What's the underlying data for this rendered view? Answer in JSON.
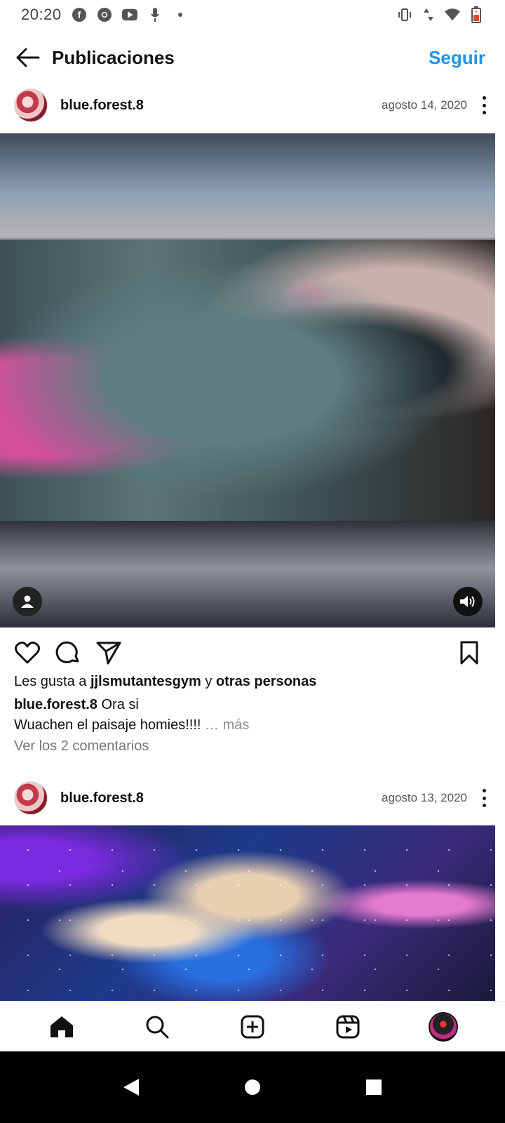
{
  "status_bar": {
    "time": "20:20",
    "icons_left": [
      "facebook-icon",
      "chrome-icon",
      "youtube-icon",
      "mic-icon",
      "dot-icon"
    ],
    "icons_right": [
      "vibrate-icon",
      "data-arrows-icon",
      "wifi-icon",
      "battery-icon"
    ]
  },
  "header": {
    "title": "Publicaciones",
    "follow_label": "Seguir"
  },
  "posts": [
    {
      "username": "blue.forest.8",
      "date": "agosto 14, 2020",
      "likes_prefix": "Les gusta a ",
      "likes_user": "jjlsmutantesgym",
      "likes_mid": " y ",
      "likes_others": "otras personas",
      "caption_user": "blue.forest.8",
      "caption_line1": " Ora si",
      "caption_line2": "Wuachen el paisaje homies!!!! ",
      "more_label": "… más",
      "comments_label": "Ver los 2 comentarios"
    },
    {
      "username": "blue.forest.8",
      "date": "agosto 13, 2020"
    }
  ],
  "colors": {
    "accent": "#1a95f0",
    "text": "#111111",
    "muted": "#8e8e8e"
  },
  "bottom_nav": [
    "home-icon",
    "search-icon",
    "new-post-icon",
    "reels-icon",
    "profile-avatar"
  ],
  "system_nav": [
    "back-triangle",
    "home-circle",
    "recents-square"
  ]
}
